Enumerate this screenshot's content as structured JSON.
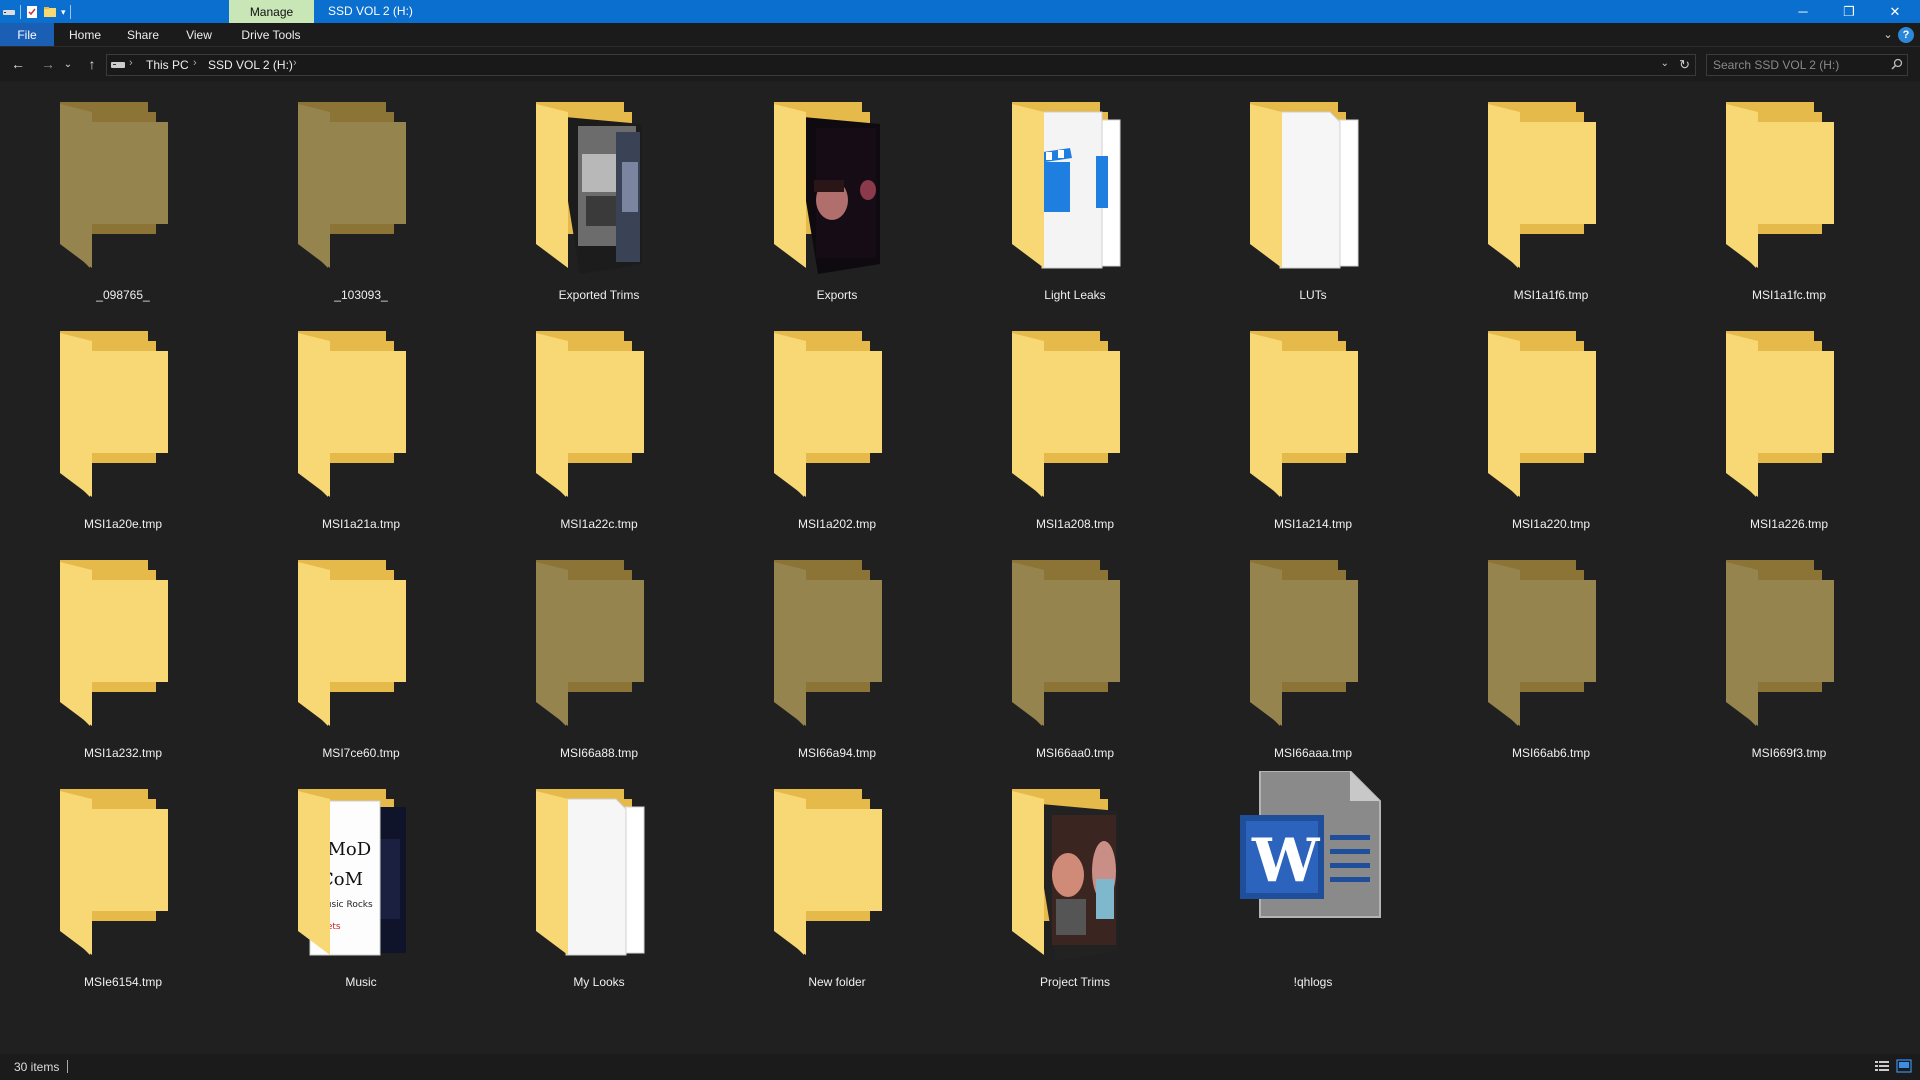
{
  "window": {
    "context_tab": "Manage",
    "title": "SSD VOL 2 (H:)",
    "minimize": "─",
    "restore": "❐",
    "close": "✕"
  },
  "ribbon": {
    "tabs": [
      "File",
      "Home",
      "Share",
      "View",
      "Drive Tools"
    ],
    "expand": "⌄",
    "help": "?"
  },
  "nav": {
    "back": "←",
    "forward": "→",
    "recent": "⌄",
    "up": "↑"
  },
  "address": {
    "crumbs": [
      "This PC",
      "SSD VOL 2 (H:)"
    ],
    "separator": "›",
    "dropdown": "⌄",
    "refresh": "↻"
  },
  "search": {
    "placeholder": "Search SSD VOL 2 (H:)"
  },
  "items": [
    {
      "name": "_098765_",
      "kind": "folder-hidden"
    },
    {
      "name": "_103093_",
      "kind": "folder-hidden"
    },
    {
      "name": "Exported Trims",
      "kind": "folder-photo-a"
    },
    {
      "name": "Exports",
      "kind": "folder-photo-b"
    },
    {
      "name": "Light Leaks",
      "kind": "folder-clapper"
    },
    {
      "name": "LUTs",
      "kind": "folder-docs"
    },
    {
      "name": "MSI1a1f6.tmp",
      "kind": "folder"
    },
    {
      "name": "MSI1a1fc.tmp",
      "kind": "folder"
    },
    {
      "name": "MSI1a20e.tmp",
      "kind": "folder"
    },
    {
      "name": "MSI1a21a.tmp",
      "kind": "folder"
    },
    {
      "name": "MSI1a22c.tmp",
      "kind": "folder"
    },
    {
      "name": "MSI1a202.tmp",
      "kind": "folder"
    },
    {
      "name": "MSI1a208.tmp",
      "kind": "folder"
    },
    {
      "name": "MSI1a214.tmp",
      "kind": "folder"
    },
    {
      "name": "MSI1a220.tmp",
      "kind": "folder"
    },
    {
      "name": "MSI1a226.tmp",
      "kind": "folder"
    },
    {
      "name": "MSI1a232.tmp",
      "kind": "folder"
    },
    {
      "name": "MSI7ce60.tmp",
      "kind": "folder"
    },
    {
      "name": "MSI66a88.tmp",
      "kind": "folder-hidden"
    },
    {
      "name": "MSI66a94.tmp",
      "kind": "folder-hidden"
    },
    {
      "name": "MSI66aa0.tmp",
      "kind": "folder-hidden"
    },
    {
      "name": "MSI66aaa.tmp",
      "kind": "folder-hidden"
    },
    {
      "name": "MSI66ab6.tmp",
      "kind": "folder-hidden"
    },
    {
      "name": "MSI669f3.tmp",
      "kind": "folder-hidden"
    },
    {
      "name": "MSIe6154.tmp",
      "kind": "folder"
    },
    {
      "name": "Music",
      "kind": "folder-music"
    },
    {
      "name": "My Looks",
      "kind": "folder-docs"
    },
    {
      "name": "New folder",
      "kind": "folder"
    },
    {
      "name": "Project Trims",
      "kind": "folder-photo-c"
    },
    {
      "name": "!qhlogs",
      "kind": "word-document"
    }
  ],
  "status": {
    "item_count": "30 items"
  },
  "colors": {
    "titlebar": "#0a6fce",
    "manage_tab": "#c9e6b7",
    "folder_front": "#f8d775",
    "folder_back": "#e5b94a",
    "background": "#202020"
  }
}
